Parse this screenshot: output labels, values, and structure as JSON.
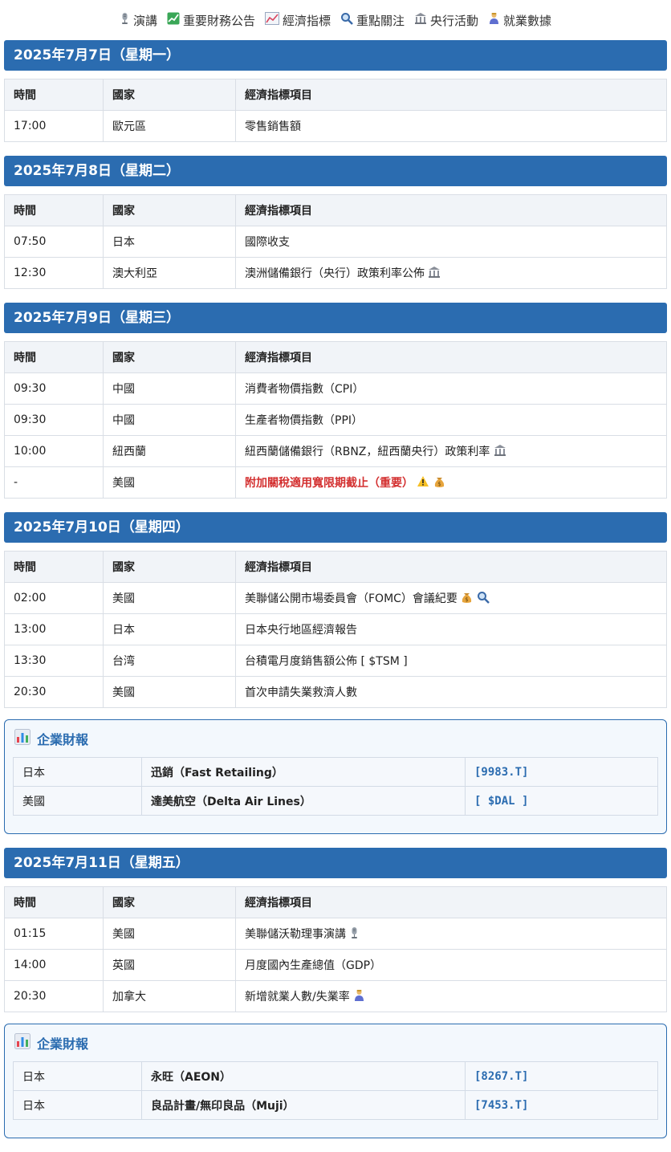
{
  "legend": [
    {
      "icon": "microphone-icon",
      "label": "演講"
    },
    {
      "icon": "chart-up-icon",
      "label": "重要財務公告"
    },
    {
      "icon": "trend-icon",
      "label": "經濟指標"
    },
    {
      "icon": "magnifier-icon",
      "label": "重點關注"
    },
    {
      "icon": "bank-icon",
      "label": "央行活動"
    },
    {
      "icon": "worker-icon",
      "label": "就業數據"
    }
  ],
  "headers": {
    "time": "時間",
    "country": "國家",
    "item": "經濟指標項目"
  },
  "days": [
    {
      "title": "2025年7月7日（星期一）",
      "rows": [
        {
          "time": "17:00",
          "country": "歐元區",
          "item": "零售銷售額",
          "icons": []
        }
      ]
    },
    {
      "title": "2025年7月8日（星期二）",
      "rows": [
        {
          "time": "07:50",
          "country": "日本",
          "item": "國際收支",
          "icons": []
        },
        {
          "time": "12:30",
          "country": "澳大利亞",
          "item": "澳洲儲備銀行（央行）政策利率公佈",
          "icons": [
            "bank-icon"
          ]
        }
      ]
    },
    {
      "title": "2025年7月9日（星期三）",
      "rows": [
        {
          "time": "09:30",
          "country": "中國",
          "item": "消費者物價指數（CPI）",
          "icons": []
        },
        {
          "time": "09:30",
          "country": "中國",
          "item": "生產者物價指數（PPI）",
          "icons": []
        },
        {
          "time": "10:00",
          "country": "紐西蘭",
          "item": "紐西蘭儲備銀行（RBNZ，紐西蘭央行）政策利率",
          "icons": [
            "bank-icon"
          ]
        },
        {
          "time": "-",
          "country": "美國",
          "item": "附加關稅適用寬限期截止（重要）",
          "important": true,
          "icons": [
            "warning-icon",
            "money-bag-icon"
          ]
        }
      ]
    },
    {
      "title": "2025年7月10日（星期四）",
      "rows": [
        {
          "time": "02:00",
          "country": "美國",
          "item": "美聯儲公開市場委員會（FOMC）會議紀要",
          "icons": [
            "money-bag-icon",
            "magnifier-icon"
          ]
        },
        {
          "time": "13:00",
          "country": "日本",
          "item": "日本央行地區經濟報告",
          "icons": []
        },
        {
          "time": "13:30",
          "country": "台湾",
          "item": "台積電月度銷售額公佈 [ $TSM ]",
          "icons": []
        },
        {
          "time": "20:30",
          "country": "美國",
          "item": "首次申請失業救濟人數",
          "icons": []
        }
      ],
      "earnings": {
        "title": "企業財報",
        "rows": [
          {
            "country": "日本",
            "company": "迅銷（Fast Retailing）",
            "ticker": "[9983.T]"
          },
          {
            "country": "美國",
            "company": "達美航空（Delta Air Lines）",
            "ticker": "[ $DAL ]"
          }
        ]
      }
    },
    {
      "title": "2025年7月11日（星期五）",
      "rows": [
        {
          "time": "01:15",
          "country": "美國",
          "item": "美聯儲沃勒理事演講",
          "icons": [
            "microphone-icon"
          ]
        },
        {
          "time": "14:00",
          "country": "英國",
          "item": "月度國內生產總值（GDP）",
          "icons": []
        },
        {
          "time": "20:30",
          "country": "加拿大",
          "item": "新增就業人數/失業率",
          "icons": [
            "worker-icon"
          ]
        }
      ],
      "earnings": {
        "title": "企業財報",
        "rows": [
          {
            "country": "日本",
            "company": "永旺（AEON）",
            "ticker": "[8267.T]"
          },
          {
            "country": "日本",
            "company": "良品計畫/無印良品（Muji）",
            "ticker": "[7453.T]"
          }
        ]
      }
    }
  ]
}
